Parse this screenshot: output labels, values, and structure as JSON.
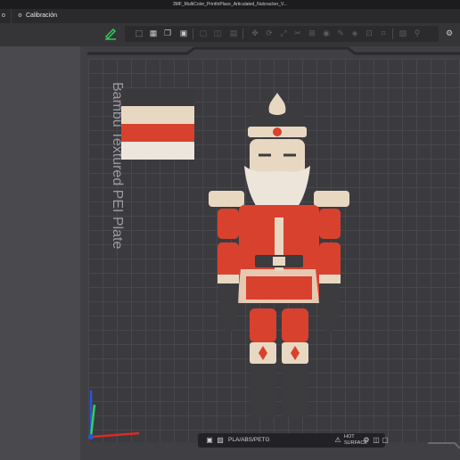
{
  "window": {
    "title": "3MF_MultiColor_PrintInPlace_Articulated_Nutcracker_V..."
  },
  "tabs": {
    "prev_tab_label": "o",
    "active_tab": {
      "label": "Calibración",
      "icon": "gear-icon"
    }
  },
  "toolbar": {
    "left_tool_icon": "edit-pencil-icon",
    "tools": [
      "cube-icon",
      "grid-icon",
      "copy-icon",
      "box-icon",
      "arrange-icon",
      "orient-icon",
      "move-icon",
      "rotate-icon",
      "scale-icon",
      "cut-icon",
      "support-icon",
      "seam-icon",
      "paint-icon",
      "text-icon",
      "measure-icon",
      "assemble-icon",
      "slice-icon",
      "variable-icon",
      "view-icon",
      "settings-icon"
    ]
  },
  "bed": {
    "plate_label": "Bambu Textured PEI Plate",
    "swatch_colors": [
      "#3a3a3c",
      "#e8d8c2",
      "#d9412f",
      "#ece6dc"
    ]
  },
  "status": {
    "filament_label": "PLA/ABS/PETG",
    "surface_label_line1": "HOT",
    "surface_label_line2": "SURFACE"
  },
  "colors": {
    "accent": "#2ed35a",
    "bed": "#3b3b3f",
    "model_red": "#d9412f",
    "model_cream": "#e8d8c2",
    "model_black": "#3c3c3e",
    "axis_x": "#d92a2a",
    "axis_y": "#2ed35a",
    "axis_z": "#2b55e0"
  }
}
